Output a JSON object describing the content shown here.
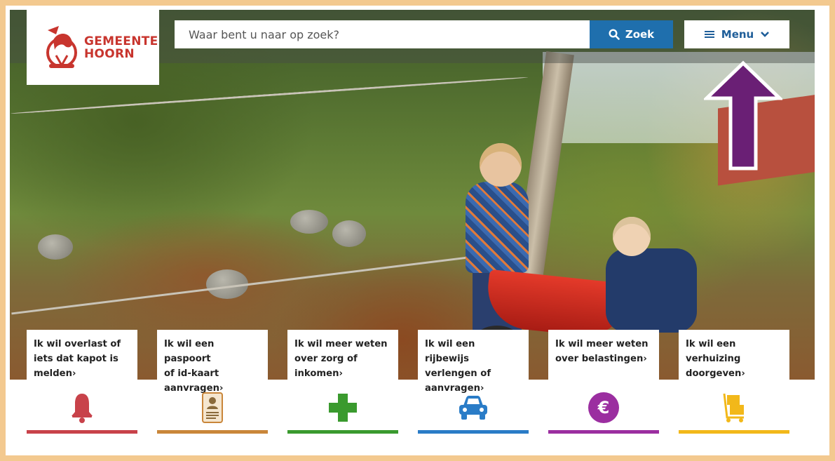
{
  "header": {
    "logo_line1": "GEMEENTE",
    "logo_line2": "HOORN",
    "search_placeholder": "Waar bent u naar op zoek?",
    "search_button": "Zoek",
    "menu_button": "Menu"
  },
  "colors": {
    "brand_red": "#c8352e",
    "search_blue": "#1f6fad",
    "arrow_purple": "#6a1f75",
    "frame_border": "#f3c98f"
  },
  "tiles": [
    {
      "lines": [
        "Ik wil overlast of",
        "iets dat kapot is",
        "melden"
      ],
      "icon": "bell-icon",
      "color": "#c8424a"
    },
    {
      "lines": [
        "Ik wil een paspoort",
        "of id-kaart",
        "aanvragen"
      ],
      "icon": "id-card-icon",
      "color": "#c9863a"
    },
    {
      "lines": [
        "Ik wil meer weten",
        "over zorg of",
        "inkomen"
      ],
      "icon": "plus-icon",
      "color": "#3a9a2e"
    },
    {
      "lines": [
        "Ik wil een rijbewijs",
        "verlengen of",
        "aanvragen"
      ],
      "icon": "car-icon",
      "color": "#2a7cc7"
    },
    {
      "lines": [
        "Ik wil meer weten",
        "over belastingen"
      ],
      "icon": "euro-icon",
      "color": "#9b2ea0"
    },
    {
      "lines": [
        "Ik wil een",
        "verhuizing",
        "doorgeven"
      ],
      "icon": "moving-cart-icon",
      "color": "#f2b81a"
    }
  ]
}
